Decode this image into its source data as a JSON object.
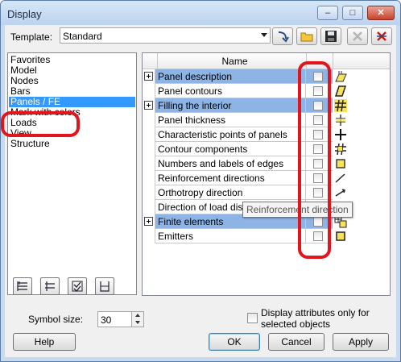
{
  "window": {
    "title": "Display",
    "minimize_glyph": "–",
    "maximize_glyph": "□",
    "close_glyph": "✕"
  },
  "template": {
    "label": "Template:",
    "value": "Standard"
  },
  "toolbar": [
    "apply-template-icon",
    "open-folder-icon",
    "save-icon",
    "delete-icon",
    "clear-icon"
  ],
  "categories": [
    {
      "label": "Favorites",
      "selected": false
    },
    {
      "label": "Model",
      "selected": false
    },
    {
      "label": "Nodes",
      "selected": false
    },
    {
      "label": "Bars",
      "selected": false
    },
    {
      "label": "Panels / FE",
      "selected": true
    },
    {
      "label": "Mark with colors",
      "selected": false
    },
    {
      "label": "Loads",
      "selected": false
    },
    {
      "label": "View",
      "selected": false
    },
    {
      "label": "Structure",
      "selected": false
    }
  ],
  "grid": {
    "header": "Name",
    "rows": [
      {
        "name": "Panel description",
        "group": true,
        "icon": "panel-description-icon"
      },
      {
        "name": "Panel contours",
        "group": false,
        "icon": "panel-contours-icon"
      },
      {
        "name": "Filling the interior",
        "group": true,
        "icon": "hatch-icon"
      },
      {
        "name": "Panel thickness",
        "group": false,
        "icon": "thickness-icon"
      },
      {
        "name": "Characteristic points of panels",
        "group": false,
        "icon": "points-icon"
      },
      {
        "name": "Contour components",
        "group": false,
        "icon": "contour-components-icon"
      },
      {
        "name": "Numbers and labels of edges",
        "group": false,
        "icon": "edge-labels-icon"
      },
      {
        "name": "Reinforcement directions",
        "group": false,
        "icon": "reinforcement-icon"
      },
      {
        "name": "Orthotropy direction",
        "group": false,
        "icon": "orthotropy-icon"
      },
      {
        "name": "Direction of load distribution",
        "group": false,
        "icon": "load-distribution-icon"
      },
      {
        "name": "Finite elements",
        "group": true,
        "icon": "finite-elements-icon"
      },
      {
        "name": "Emitters",
        "group": false,
        "icon": "emitters-icon"
      }
    ]
  },
  "tooltip": "Reinforcement direction",
  "symbol_size": {
    "label": "Symbol size:",
    "value": "30"
  },
  "attributes_option": {
    "line1": "Display attributes only for",
    "line2": "selected objects",
    "checked": false
  },
  "buttons": {
    "help": "Help",
    "ok": "OK",
    "cancel": "Cancel",
    "apply": "Apply"
  },
  "colors": {
    "selection": "#3399ff",
    "group_row": "#8eb4e6",
    "highlight": "#e4141c"
  }
}
